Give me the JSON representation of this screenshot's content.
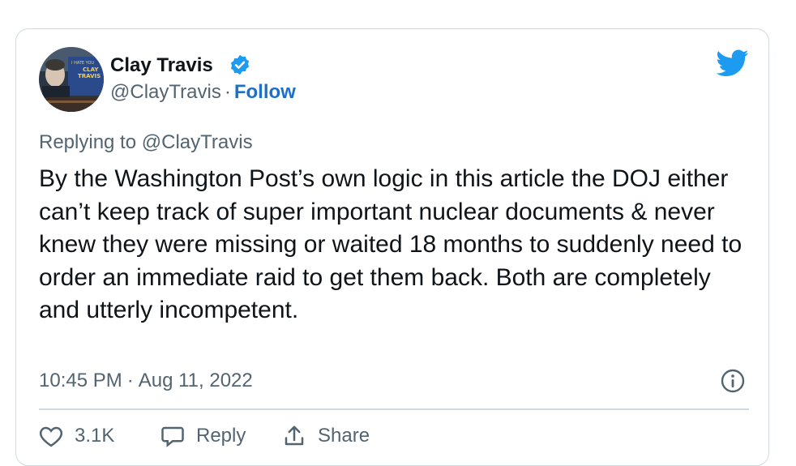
{
  "author": {
    "display_name": "Clay Travis",
    "handle": "@ClayTravis",
    "separator": "·",
    "follow_label": "Follow",
    "avatar_sign_text": [
      "I HATE YOU",
      "CLAY",
      "TRAVIS"
    ]
  },
  "tweet": {
    "replying_prefix": "Replying to ",
    "replying_handle": "@ClayTravis",
    "text": "By the Washington Post’s own logic in this article the DOJ either can’t keep track of super important nuclear documents & never knew they were missing or waited 18 months to suddenly need to order an immediate raid to get them back. Both are completely and utterly incompetent.",
    "time": "10:45 PM",
    "date_separator": "·",
    "date": "Aug 11, 2022"
  },
  "actions": {
    "like_count": "3.1K",
    "reply_label": "Reply",
    "share_label": "Share"
  },
  "colors": {
    "brand_blue": "#1d9bf0",
    "follow_blue": "#1d6fc9",
    "text_primary": "#0f1419",
    "text_secondary": "#536471",
    "border": "#cfd9de"
  },
  "icons": {
    "verified": "verified-badge-icon",
    "logo": "twitter-bird-icon",
    "info": "info-circle-icon",
    "like": "heart-icon",
    "reply": "speech-bubble-icon",
    "share": "share-upload-icon"
  }
}
